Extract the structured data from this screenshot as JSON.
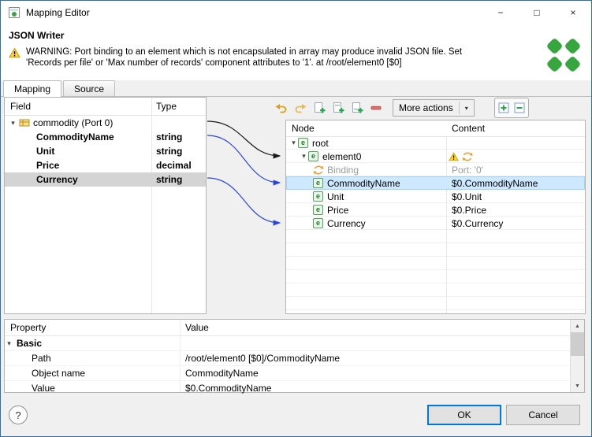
{
  "window": {
    "title": "Mapping Editor"
  },
  "icons": {
    "minimize": "−",
    "maximize": "□",
    "close": "×",
    "chevron_expanded": "▾",
    "dropdown": "▾",
    "element": "e",
    "scroll_up": "▲",
    "scroll_down": "▼"
  },
  "header": {
    "title": "JSON Writer",
    "warning_text": "WARNING: Port binding to an element which is not encapsulated in array may produce invalid JSON file. Set 'Records per file' or 'Max number of records' component attributes to '1'. at /root/element0 [$0]"
  },
  "tabs": [
    {
      "label": "Mapping"
    },
    {
      "label": "Source"
    }
  ],
  "field_table": {
    "columns": [
      "Field",
      "Type"
    ],
    "root_label": "commodity (Port 0)",
    "rows": [
      {
        "field": "CommodityName",
        "type": "string"
      },
      {
        "field": "Unit",
        "type": "string"
      },
      {
        "field": "Price",
        "type": "decimal"
      },
      {
        "field": "Currency",
        "type": "string",
        "selected": true
      }
    ]
  },
  "toolbar": {
    "more_actions": "More actions"
  },
  "node_table": {
    "columns": [
      "Node",
      "Content"
    ],
    "rows": [
      {
        "label": "root",
        "content": ""
      },
      {
        "label": "element0",
        "content": ""
      },
      {
        "label": "Binding",
        "content": "Port: '0'"
      },
      {
        "label": "CommodityName",
        "content": "$0.CommodityName",
        "selected": true
      },
      {
        "label": "Unit",
        "content": "$0.Unit"
      },
      {
        "label": "Price",
        "content": "$0.Price"
      },
      {
        "label": "Currency",
        "content": "$0.Currency"
      }
    ]
  },
  "property_table": {
    "columns": [
      "Property",
      "Value"
    ],
    "group_label": "Basic",
    "rows": [
      {
        "property": "Path",
        "value": "/root/element0 [$0]/CommodityName"
      },
      {
        "property": "Object name",
        "value": "CommodityName"
      },
      {
        "property": "Value",
        "value": "$0.CommodityName"
      }
    ]
  },
  "footer": {
    "help": "?",
    "ok": "OK",
    "cancel": "Cancel"
  },
  "colors": {
    "accent": "#0078d7",
    "selection_blue": "#cde8ff",
    "selection_gray": "#d4d4d4",
    "warning_yellow": "#ffd42a",
    "clover_green": "#38a63f",
    "binding_orange": "#e8a33d"
  }
}
